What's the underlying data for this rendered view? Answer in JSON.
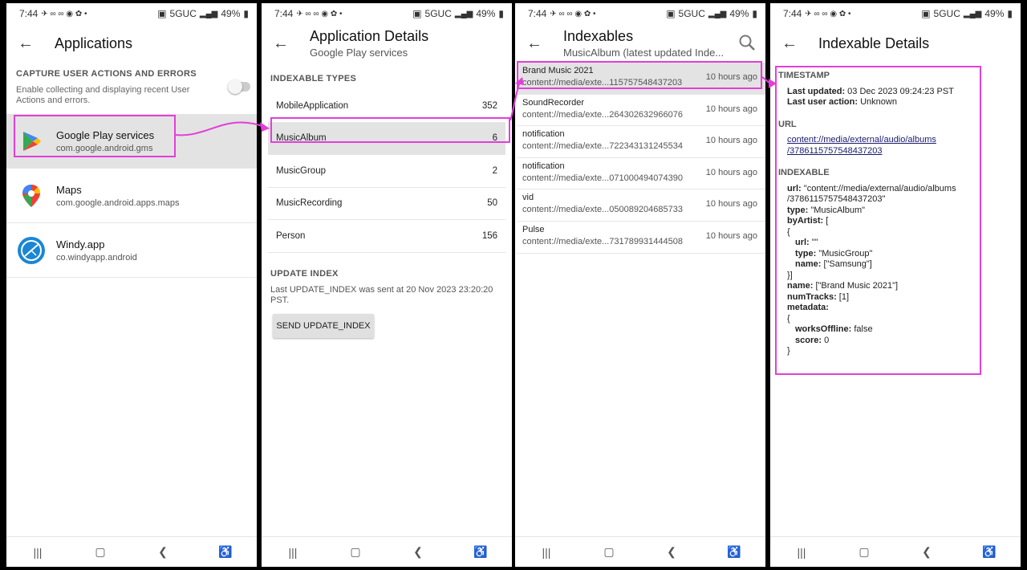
{
  "status": {
    "time": "7:44",
    "network": "5GUC",
    "battery": "49%"
  },
  "screen1": {
    "title": "Applications",
    "capture": {
      "heading": "CAPTURE USER ACTIONS AND ERRORS",
      "description": "Enable collecting and displaying recent User Actions and errors."
    },
    "apps": [
      {
        "name": "Google Play services",
        "package": "com.google.android.gms",
        "icon": "google-play-services-icon"
      },
      {
        "name": "Maps",
        "package": "com.google.android.apps.maps",
        "icon": "maps-icon"
      },
      {
        "name": "Windy.app",
        "package": "co.windyapp.android",
        "icon": "windy-icon"
      }
    ]
  },
  "screen2": {
    "title": "Application Details",
    "subtitle": "Google Play services",
    "types_heading": "INDEXABLE TYPES",
    "types": [
      {
        "name": "MobileApplication",
        "count": "352"
      },
      {
        "name": "MusicAlbum",
        "count": "6"
      },
      {
        "name": "MusicGroup",
        "count": "2"
      },
      {
        "name": "MusicRecording",
        "count": "50"
      },
      {
        "name": "Person",
        "count": "156"
      }
    ],
    "update_heading": "UPDATE INDEX",
    "update_text": "Last UPDATE_INDEX was sent at 20 Nov 2023 23:20:20 PST.",
    "update_button": "SEND UPDATE_INDEX"
  },
  "screen3": {
    "title": "Indexables",
    "subtitle": "MusicAlbum (latest updated Inde...",
    "items": [
      {
        "name": "Brand Music 2021",
        "url": "content://media/exte...115757548437203",
        "time": "10 hours ago"
      },
      {
        "name": "SoundRecorder",
        "url": "content://media/exte...264302632966076",
        "time": "10 hours ago"
      },
      {
        "name": "notification",
        "url": "content://media/exte...722343131245534",
        "time": "10 hours ago"
      },
      {
        "name": "notification",
        "url": "content://media/exte...071000494074390",
        "time": "10 hours ago"
      },
      {
        "name": "vid",
        "url": "content://media/exte...050089204685733",
        "time": "10 hours ago"
      },
      {
        "name": "Pulse",
        "url": "content://media/exte...731789931444508",
        "time": "10 hours ago"
      }
    ]
  },
  "screen4": {
    "title": "Indexable Details",
    "timestamp_heading": "TIMESTAMP",
    "last_updated_label": "Last updated:",
    "last_updated_value": " 03 Dec 2023 09:24:23 PST",
    "last_action_label": "Last user action:",
    "last_action_value": " Unknown",
    "url_heading": "URL",
    "url_line1": "content://media/external/audio/albums",
    "url_line2": "/3786115757548437203",
    "indexable_heading": "INDEXABLE",
    "lines": {
      "url_label": "url:",
      "url_value1": " \"content://media/external/audio/albums",
      "url_value2": "/3786115757548437203\"",
      "type_label": "type:",
      "type_value": " \"MusicAlbum\"",
      "byartist_label": "byArtist:",
      "byartist_value": " [",
      "open_brace": "{",
      "inner_url_label": "url:",
      "inner_url_value": " \"\"",
      "inner_type_label": "type:",
      "inner_type_value": " \"MusicGroup\"",
      "inner_name_label": "name:",
      "inner_name_value": " [\"Samsung\"]",
      "close_brace_bracket": "}]",
      "name_label": "name:",
      "name_value": " [\"Brand Music 2021\"]",
      "numtracks_label": "numTracks:",
      "numtracks_value": " [1]",
      "metadata_label": "metadata:",
      "meta_open": "{",
      "works_label": "worksOffline:",
      "works_value": " false",
      "score_label": "score:",
      "score_value": " 0",
      "meta_close": "}"
    }
  },
  "colors": {
    "highlight": "#e23fd9",
    "selected_row": "#e3e3e3"
  }
}
